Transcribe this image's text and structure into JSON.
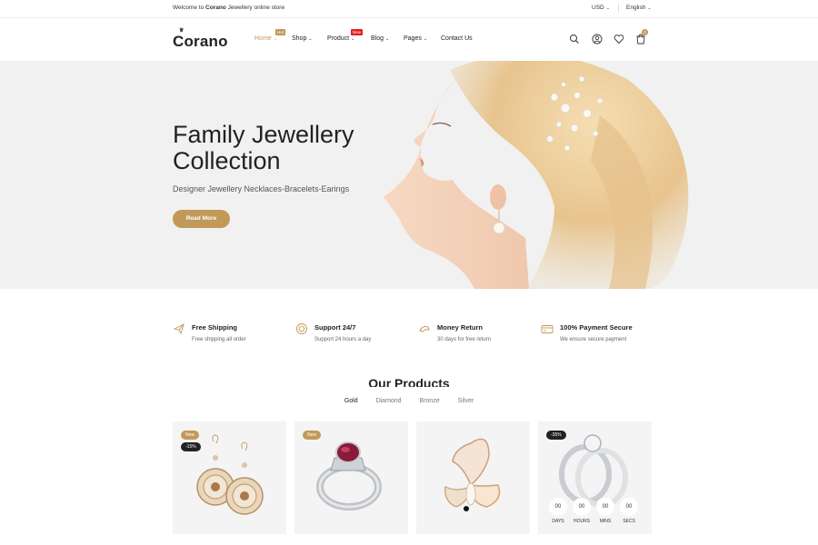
{
  "topbar": {
    "welcome_prefix": "Welcome to ",
    "welcome_brand": "Corano",
    "welcome_suffix": " Jewellery online store",
    "currency": "USD",
    "language": "English"
  },
  "header": {
    "logo": "Corano",
    "nav": [
      {
        "label": "Home",
        "badge": "Hot"
      },
      {
        "label": "Shop"
      },
      {
        "label": "Product",
        "badge": "New"
      },
      {
        "label": "Blog"
      },
      {
        "label": "Pages"
      },
      {
        "label": "Contact Us"
      }
    ],
    "cart_count": "0",
    "icons": [
      "search-icon",
      "account-icon",
      "wishlist-icon",
      "cart-icon"
    ]
  },
  "hero": {
    "title_line1": "Family Jewellery",
    "title_line2": "Collection",
    "subtitle": "Designer Jewellery Necklaces-Bracelets-Earings",
    "button": "Read More"
  },
  "services": [
    {
      "title": "Free Shipping",
      "desc": "Free shipping all order",
      "icon": "plane-icon"
    },
    {
      "title": "Support 24/7",
      "desc": "Support 24 hours a day",
      "icon": "support-icon"
    },
    {
      "title": "Money Return",
      "desc": "30 days for free return",
      "icon": "money-return-icon"
    },
    {
      "title": "100% Payment Secure",
      "desc": "We ensure secure payment",
      "icon": "credit-card-icon"
    }
  ],
  "products": {
    "title": "Our Products",
    "tabs": [
      "Gold",
      "Diamond",
      "Bronze",
      "Silver"
    ],
    "active_tab": "Gold",
    "cards": [
      {
        "tag_new": "New",
        "tag_discount": "-15%"
      },
      {
        "tag_new": "New"
      },
      {},
      {
        "tag_discount": "-35%",
        "countdown": [
          {
            "value": "00",
            "label": "DAYS"
          },
          {
            "value": "00",
            "label": "HOURS"
          },
          {
            "value": "00",
            "label": "MINS"
          },
          {
            "value": "00",
            "label": "SECS"
          }
        ]
      }
    ]
  },
  "colors": {
    "accent": "#c29958",
    "badge_new": "#e02020",
    "dark": "#222222"
  }
}
